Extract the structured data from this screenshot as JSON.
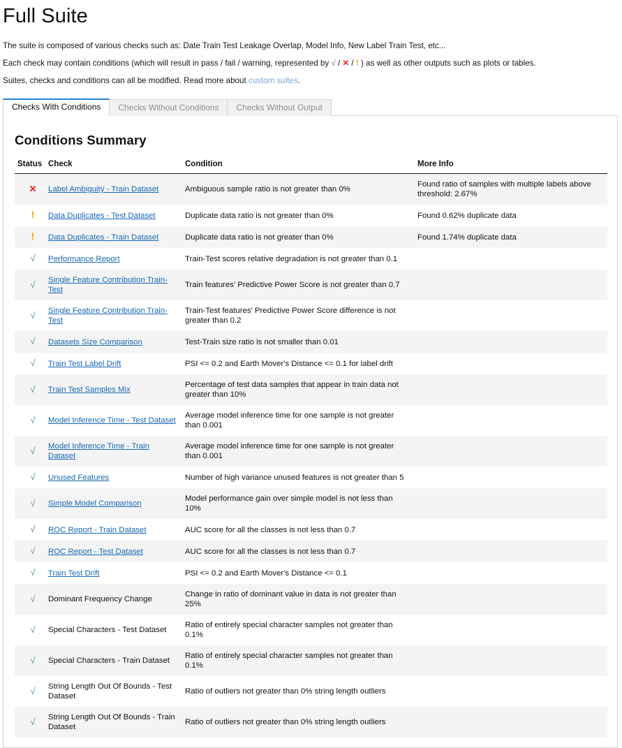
{
  "header": {
    "title": "Full Suite",
    "intro_lines": [
      {
        "segments": [
          {
            "text": "The suite is composed of various checks such as: Date Train Test Leakage Overlap, Model Info, New Label Train Test, etc...",
            "kind": "text"
          }
        ]
      },
      {
        "segments": [
          {
            "text": "Each check may contain conditions (which will result in pass / fail / warning, represented by ",
            "kind": "text"
          },
          {
            "text": "√",
            "kind": "sym-pass"
          },
          {
            "text": " / ",
            "kind": "text"
          },
          {
            "text": "✕",
            "kind": "sym-fail"
          },
          {
            "text": " / ",
            "kind": "text"
          },
          {
            "text": "!",
            "kind": "sym-warn"
          },
          {
            "text": " ) as well as other outputs such as plots or tables.",
            "kind": "text"
          }
        ]
      },
      {
        "segments": [
          {
            "text": "Suites, checks and conditions can all be modified. Read more about ",
            "kind": "text"
          },
          {
            "text": "custom suites",
            "kind": "link"
          },
          {
            "text": ".",
            "kind": "text"
          }
        ]
      }
    ]
  },
  "tabs": [
    {
      "label": "Checks With Conditions",
      "active": true
    },
    {
      "label": "Checks Without Conditions",
      "active": false
    },
    {
      "label": "Checks Without Output",
      "active": false
    }
  ],
  "main": {
    "section_title": "Conditions Summary",
    "columns": [
      "Status",
      "Check",
      "Condition",
      "More Info"
    ],
    "status_glyphs": {
      "pass": "√",
      "fail": "✕",
      "warn": "!"
    },
    "colors": {
      "pass": "#4c9a6b",
      "fail": "#e8291c",
      "warn": "#f29f05",
      "link": "#1667b5",
      "inline_link": "#7ba7d7",
      "accent_tab": "#1e87d6",
      "row_shaded": "#f4f4f4"
    },
    "rows": [
      {
        "status": "fail",
        "check": "Label Ambiguity - Train Dataset",
        "is_link": true,
        "condition": "Ambiguous sample ratio is not greater than 0%",
        "more_info": "Found ratio of samples with multiple labels above threshold: 2.67%"
      },
      {
        "status": "warn",
        "check": "Data Duplicates - Test Dataset",
        "is_link": true,
        "condition": "Duplicate data ratio is not greater than 0%",
        "more_info": "Found 0.62% duplicate data"
      },
      {
        "status": "warn",
        "check": "Data Duplicates - Train Dataset",
        "is_link": true,
        "condition": "Duplicate data ratio is not greater than 0%",
        "more_info": "Found 1.74% duplicate data"
      },
      {
        "status": "pass",
        "check": "Performance Report",
        "is_link": true,
        "condition": "Train-Test scores relative degradation is not greater than 0.1",
        "more_info": ""
      },
      {
        "status": "pass",
        "check": "Single Feature Contribution Train-Test",
        "is_link": true,
        "condition": "Train features' Predictive Power Score is not greater than 0.7",
        "more_info": ""
      },
      {
        "status": "pass",
        "check": "Single Feature Contribution Train-Test",
        "is_link": true,
        "condition": "Train-Test features' Predictive Power Score difference is not greater than 0.2",
        "more_info": ""
      },
      {
        "status": "pass",
        "check": "Datasets Size Comparison",
        "is_link": true,
        "condition": "Test-Train size ratio is not smaller than 0.01",
        "more_info": ""
      },
      {
        "status": "pass",
        "check": "Train Test Label Drift",
        "is_link": true,
        "condition": "PSI <= 0.2 and Earth Mover's Distance <= 0.1 for label drift",
        "more_info": ""
      },
      {
        "status": "pass",
        "check": "Train Test Samples Mix",
        "is_link": true,
        "condition": "Percentage of test data samples that appear in train data not greater than 10%",
        "more_info": ""
      },
      {
        "status": "pass",
        "check": "Model Inference Time - Test Dataset",
        "is_link": true,
        "condition": "Average model inference time for one sample is not greater than 0.001",
        "more_info": ""
      },
      {
        "status": "pass",
        "check": "Model Inference Time - Train Dataset",
        "is_link": true,
        "condition": "Average model inference time for one sample is not greater than 0.001",
        "more_info": ""
      },
      {
        "status": "pass",
        "check": "Unused Features",
        "is_link": true,
        "condition": "Number of high variance unused features is not greater than 5",
        "more_info": ""
      },
      {
        "status": "pass",
        "check": "Simple Model Comparison",
        "is_link": true,
        "condition": "Model performance gain over simple model is not less than 10%",
        "more_info": ""
      },
      {
        "status": "pass",
        "check": "ROC Report - Train Dataset",
        "is_link": true,
        "condition": "AUC score for all the classes is not less than 0.7",
        "more_info": ""
      },
      {
        "status": "pass",
        "check": "ROC Report - Test Dataset",
        "is_link": true,
        "condition": "AUC score for all the classes is not less than 0.7",
        "more_info": ""
      },
      {
        "status": "pass",
        "check": "Train Test Drift",
        "is_link": true,
        "condition": "PSI <= 0.2 and Earth Mover's Distance <= 0.1",
        "more_info": ""
      },
      {
        "status": "pass",
        "check": "Dominant Frequency Change",
        "is_link": false,
        "condition": "Change in ratio of dominant value in data is not greater than 25%",
        "more_info": ""
      },
      {
        "status": "pass",
        "check": "Special Characters - Test Dataset",
        "is_link": false,
        "condition": "Ratio of entirely special character samples not greater than 0.1%",
        "more_info": ""
      },
      {
        "status": "pass",
        "check": "Special Characters - Train Dataset",
        "is_link": false,
        "condition": "Ratio of entirely special character samples not greater than 0.1%",
        "more_info": ""
      },
      {
        "status": "pass",
        "check": "String Length Out Of Bounds - Test Dataset",
        "is_link": false,
        "condition": "Ratio of outliers not greater than 0% string length outliers",
        "more_info": ""
      },
      {
        "status": "pass",
        "check": "String Length Out Of Bounds - Train Dataset",
        "is_link": false,
        "condition": "Ratio of outliers not greater than 0% string length outliers",
        "more_info": ""
      }
    ]
  }
}
